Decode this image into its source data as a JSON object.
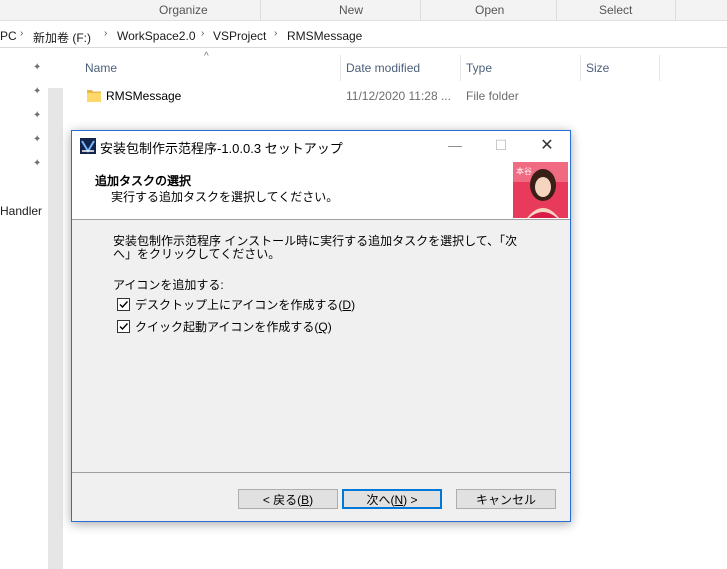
{
  "explorer": {
    "ribbon": [
      "Organize",
      "New",
      "Open",
      "Select"
    ],
    "breadcrumb": [
      "PC",
      "新加卷 (F:)",
      "WorkSpace2.0",
      "VSProject",
      "RMSMessage"
    ],
    "left_pane_partial_item": "Handler",
    "columns": [
      "Name",
      "Date modified",
      "Type",
      "Size"
    ],
    "files": [
      {
        "name": "RMSMessage",
        "date": "11/12/2020 11:28 ...",
        "type": "File folder",
        "size": ""
      }
    ]
  },
  "dialog": {
    "title": "安装包制作示范程序-1.0.0.3 セットアップ",
    "header_title": "追加タスクの選択",
    "header_subtitle": "実行する追加タスクを選択してください。",
    "body_line1": "安装包制作示范程序 インストール時に実行する追加タスクを選択して、「次",
    "body_line2": "へ」をクリックしてください。",
    "group_label": "アイコンを追加する:",
    "tasks": [
      {
        "label": "デスクトップ上にアイコンを作成する",
        "accel": "D",
        "checked": true
      },
      {
        "label": "クイック起動アイコンを作成する",
        "accel": "Q",
        "checked": true
      }
    ],
    "buttons": {
      "back": {
        "text": "< 戻る",
        "accel": "B"
      },
      "next": {
        "text": "次へ",
        "accel": "N",
        "suffix": " >"
      },
      "cancel": "キャンセル"
    },
    "accent_color": "#0078d7"
  }
}
